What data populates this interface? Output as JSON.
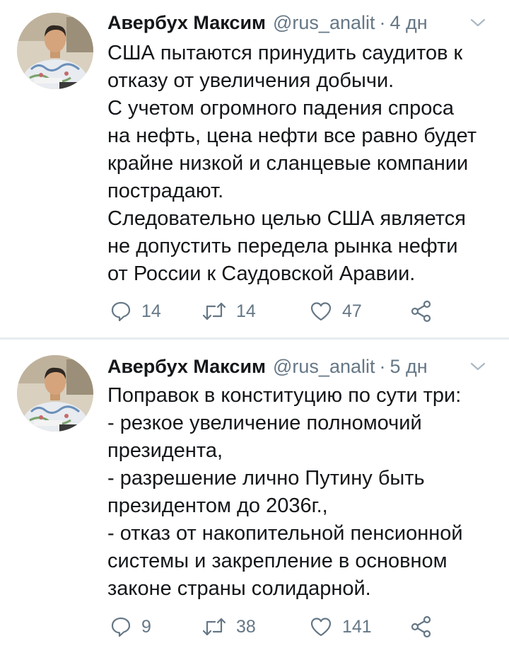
{
  "tweets": [
    {
      "author_name": "Авербух Максим",
      "handle": "@rus_analit",
      "separator": "·",
      "time": "4 дн",
      "lines": [
        "США пытаются принудить саудитов к",
        "отказу от увеличения добычи.",
        "С учетом огромного падения спроса",
        "на нефть, цена нефти все равно будет",
        "крайне низкой и сланцевые компании",
        "пострадают.",
        "Следовательно целью США является",
        "не допустить передела рынка нефти",
        "от России к Саудовской Аравии."
      ],
      "replies": "14",
      "retweets": "14",
      "likes": "47"
    },
    {
      "author_name": "Авербух Максим",
      "handle": "@rus_analit",
      "separator": "·",
      "time": "5 дн",
      "lines": [
        "Поправок в конституцию по сути три:",
        "- резкое увеличение полномочий",
        "президента,",
        "- разрешение лично Путину быть",
        "президентом до 2036г.,",
        "- отказ от накопительной пенсионной",
        "системы и закрепление в основном",
        "законе страны солидарной."
      ],
      "replies": "9",
      "retweets": "38",
      "likes": "141"
    }
  ],
  "icons": {
    "reply": "reply-icon",
    "retweet": "retweet-icon",
    "like": "heart-icon",
    "share": "share-icon",
    "menu": "chevron-down-icon"
  },
  "colors": {
    "text": "#14171a",
    "secondary": "#657786",
    "divider": "#e6ecf0"
  }
}
